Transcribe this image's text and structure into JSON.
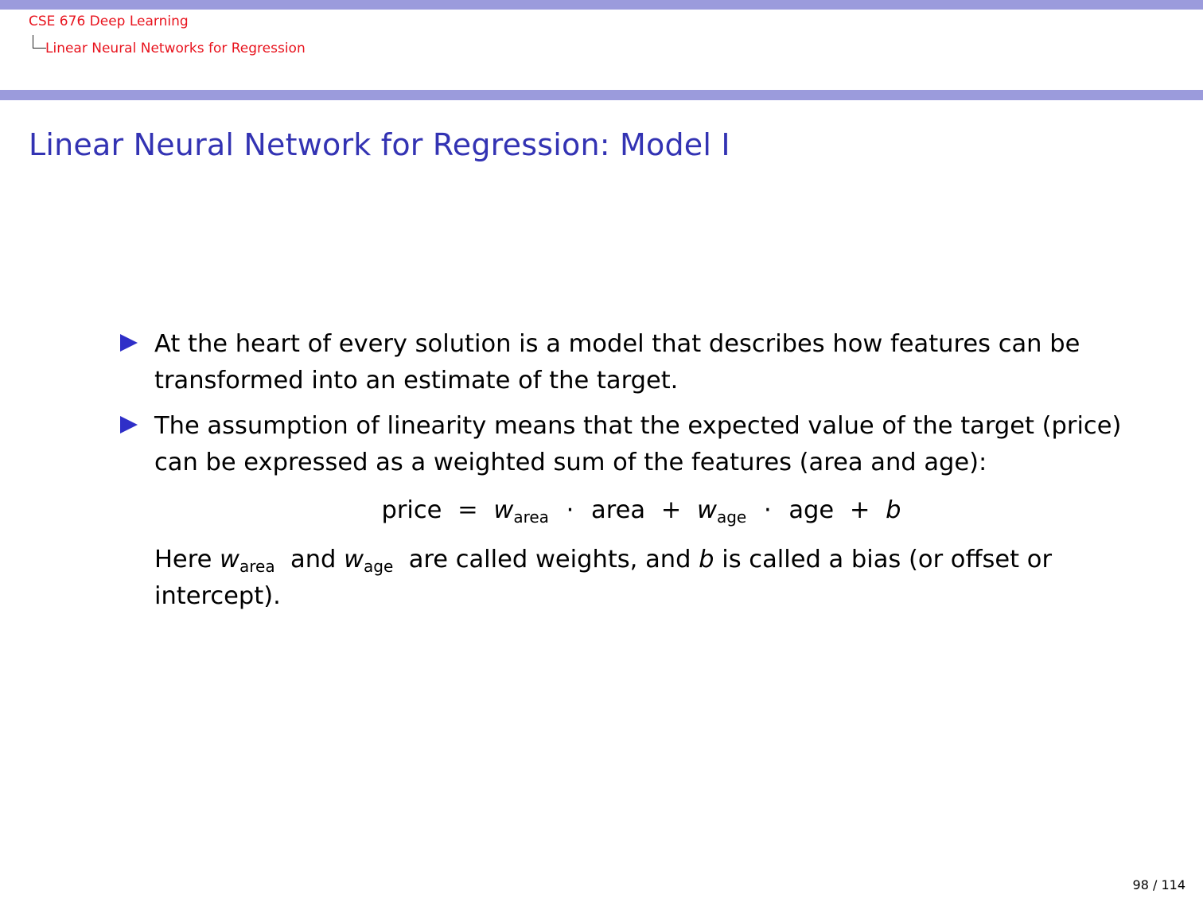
{
  "header": {
    "course": "CSE 676 Deep Learning",
    "section": "Linear Neural Networks for Regression"
  },
  "frame": {
    "title": "Linear Neural Network for Regression: Model I"
  },
  "bullets": [
    "At the heart of every solution is a model that describes how features can be transformed into an estimate of the target.",
    "The assumption of linearity means that the expected value of the target (price) can be expressed as a weighted sum of the features (area and age):"
  ],
  "equation": {
    "lhs": "price",
    "equals": "=",
    "w": "w",
    "sub_area": "area",
    "dot": "·",
    "term_area": "area",
    "plus": "+",
    "sub_age": "age",
    "term_age": "age",
    "bias": "b"
  },
  "followup": {
    "here": "Here",
    "w": "w",
    "sub_area": "area",
    "and": "and",
    "sub_age": "age",
    "middle": "are called weights, and",
    "b": "b",
    "tail": "is called a bias (or offset or intercept)."
  },
  "footer": {
    "page": "98 / 114"
  },
  "colors": {
    "bar": "#9b9bdc",
    "header_text": "#e8141e",
    "title": "#3333b3",
    "bullet_marker": "#2f2fc8"
  },
  "icons": {
    "bullet": "triangle-right-icon",
    "tree": "tree-connector-icon"
  }
}
